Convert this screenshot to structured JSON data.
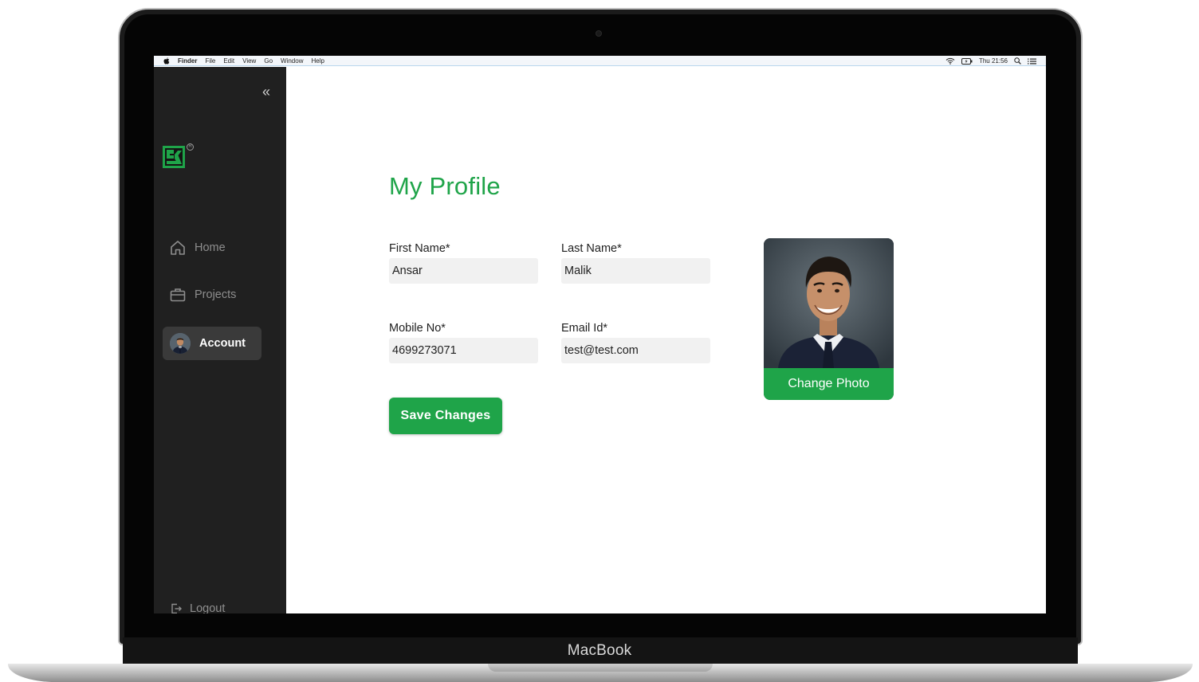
{
  "device": {
    "brand_label": "MacBook"
  },
  "menubar": {
    "app_name": "Finder",
    "menus": [
      "File",
      "Edit",
      "View",
      "Go",
      "Window",
      "Help"
    ],
    "clock": "Thu 21:56"
  },
  "sidebar": {
    "collapse_glyph": "«",
    "items": [
      {
        "label": "Home",
        "icon": "home-icon"
      },
      {
        "label": "Projects",
        "icon": "briefcase-icon"
      },
      {
        "label": "Account",
        "icon": "avatar",
        "active": true
      }
    ],
    "logout_label": "Logout"
  },
  "profile": {
    "title": "My Profile",
    "first_name": {
      "label": "First Name*",
      "value": "Ansar"
    },
    "last_name": {
      "label": "Last Name*",
      "value": "Malik"
    },
    "mobile": {
      "label": "Mobile No*",
      "value": "4699273071"
    },
    "email": {
      "label": "Email Id*",
      "value": "test@test.com"
    },
    "save_label": "Save Changes",
    "change_photo_label": "Change Photo"
  },
  "colors": {
    "accent": "#1fa449",
    "sidebar_bg": "#202020",
    "active_item_bg": "#3a3a3a",
    "input_bg": "#f1f1f1"
  }
}
